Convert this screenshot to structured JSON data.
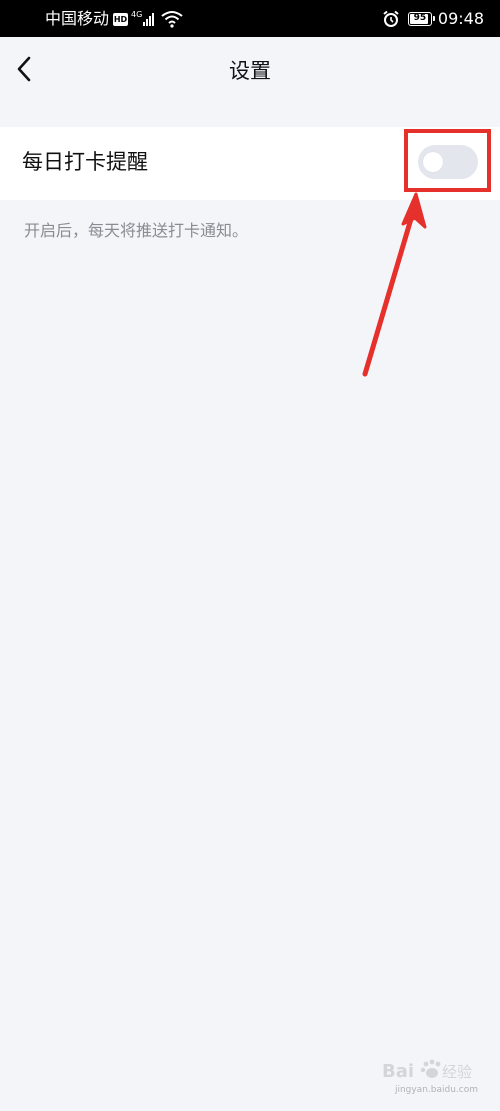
{
  "status_bar": {
    "carrier": "中国移动",
    "hd_badge": "HD",
    "network_type": "4G",
    "icons": [
      "hd-icon",
      "signal-icon",
      "wifi-icon",
      "alarm-icon",
      "battery-icon"
    ],
    "battery_level": "95",
    "battery_fraction": 0.95,
    "time": "09:48"
  },
  "nav": {
    "back_icon": "chevron-left-icon",
    "title": "设置"
  },
  "settings": {
    "daily_checkin_reminder": {
      "label": "每日打卡提醒",
      "enabled": false
    },
    "hint": "开启后，每天将推送打卡通知。"
  },
  "annotation": {
    "color": "#e5302b"
  },
  "watermark": {
    "text": "Bai du 经验",
    "subtext": "jingyan.baidu.com"
  },
  "colors": {
    "background": "#f4f5f9",
    "card": "#ffffff",
    "toggle_off": "#e4e6ed",
    "hint_text": "#8a8c93"
  }
}
